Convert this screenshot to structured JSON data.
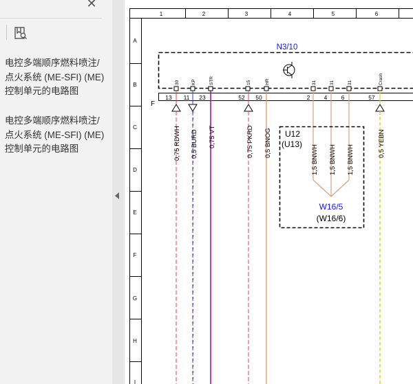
{
  "sidebar": {
    "close_glyph": "✕",
    "bookmark_icon": "bookmark-page-icon",
    "bookmarks": [
      {
        "title": "电控多端顺序燃料喷注/点火系统 (ME-SFI) (ME) 控制单元的电路图"
      },
      {
        "title": "电控多端顺序燃料喷注/点火系统 (ME-SFI) (ME) 控制单元的电路图"
      }
    ]
  },
  "diagram": {
    "columns": [
      "1",
      "2",
      "3",
      "4",
      "5",
      "6"
    ],
    "rows": [
      "A",
      "B",
      "C",
      "D",
      "E",
      "F",
      "G",
      "H",
      "I"
    ],
    "module_label": "N3/10",
    "row_f_label": "F",
    "pin_names": [
      "30",
      "KP",
      "STR",
      "15",
      "HR",
      "31",
      "31",
      "31",
      "Crash"
    ],
    "pin_numbers": [
      "13",
      "11",
      "23",
      "52",
      "50",
      "2",
      "4",
      "6",
      "57"
    ],
    "wire_labels": [
      "0,75 RDWH",
      "0,5 BURD",
      "0,75 VT",
      "0,75 PKRD",
      "0,5 BNOG",
      "1,5 BNWH",
      "1,5 BNWH",
      "1,5 BNWH",
      "0,5 YEBN"
    ],
    "u12": "U12",
    "u13": "(U13)",
    "w16_5": "W16/5",
    "w16_6": "(W16/6)",
    "colors": {
      "module_label": "#1a1acc",
      "w16_5": "#1a1acc",
      "RDWH": "#d94545",
      "BURD": "#2a3fd0",
      "VT": "#9a1aa8",
      "PKRD": "#e04060",
      "BNOG": "#e58a60",
      "BNWH": "#d9a080",
      "YEBN": "#e8d020"
    }
  }
}
